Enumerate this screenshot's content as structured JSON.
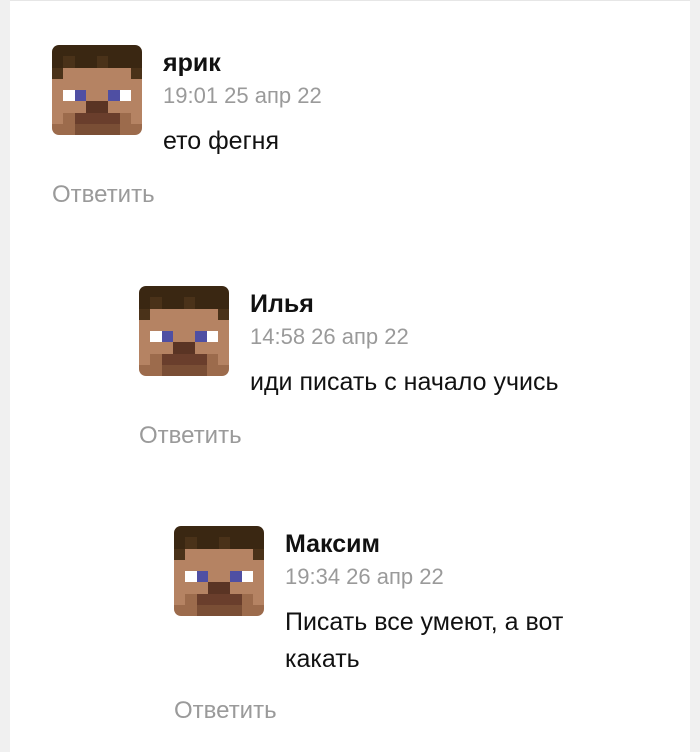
{
  "comments": [
    {
      "author": "ярик",
      "time": "19:01 25 апр 22",
      "text": "ето фегня",
      "reply_label": "Ответить",
      "avatar_icon": "minecraft-steve-avatar"
    },
    {
      "author": "Илья",
      "time": "14:58 26 апр 22",
      "text": "иди писать с начало учись",
      "reply_label": "Ответить",
      "avatar_icon": "minecraft-steve-avatar"
    },
    {
      "author": "Максим",
      "time": "19:34 26 апр 22",
      "text": "Писать все умеют, а вот какать",
      "reply_label": "Ответить",
      "avatar_icon": "minecraft-steve-avatar"
    }
  ],
  "colors": {
    "author": "#111111",
    "meta": "#9a9a9a",
    "background": "#f0f0f0",
    "card": "#ffffff"
  }
}
